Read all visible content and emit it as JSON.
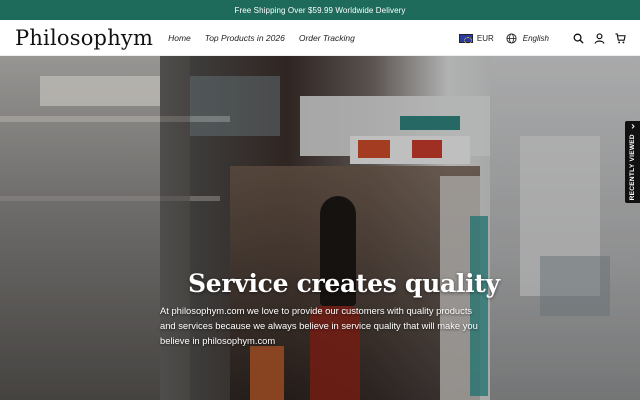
{
  "announcement": "Free Shipping Over $59.99 Worldwide Delivery",
  "brand": "Philosophym",
  "nav": [
    {
      "label": "Home"
    },
    {
      "label": "Top Products in 2026"
    },
    {
      "label": "Order Tracking"
    }
  ],
  "currency": {
    "label": "EUR",
    "flag_icon": "eu-flag-icon"
  },
  "language": {
    "label": "English",
    "icon": "globe-icon"
  },
  "header_icons": [
    "search-icon",
    "account-icon",
    "cart-icon"
  ],
  "hero": {
    "title": "Service creates quality",
    "text": "At philosophym.com we love to provide our customers with quality products and services because we always believe in service quality that will make you believe in philosophym.com"
  },
  "recently_viewed": {
    "label": "RECENTLY VIEWED",
    "icon": "chevron-left-icon"
  },
  "colors": {
    "announcement_bg": "#1e6b5c",
    "text": "#222222",
    "tab_bg": "#111111"
  }
}
